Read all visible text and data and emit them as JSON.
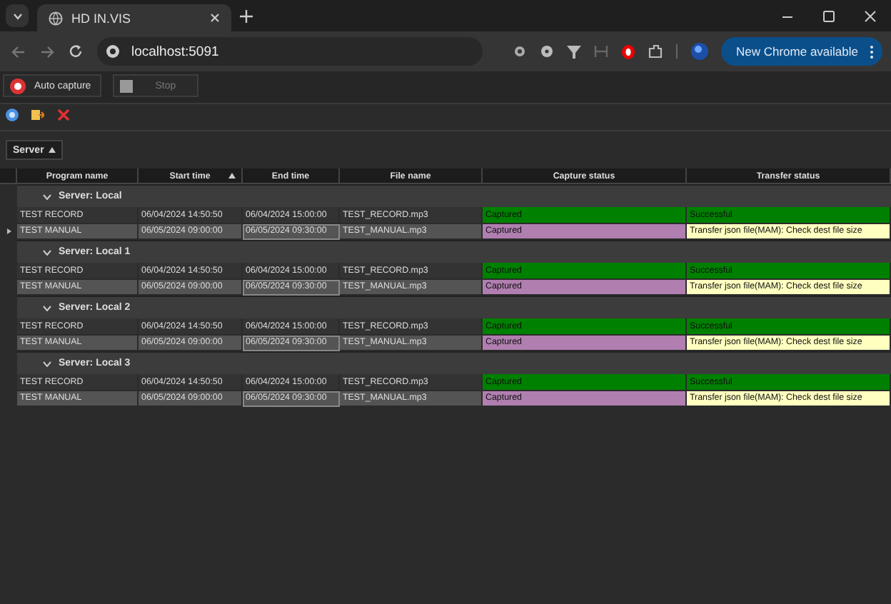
{
  "browser": {
    "tab_title": "HD IN.VIS",
    "url": "localhost:5091",
    "update_button": "New Chrome available"
  },
  "toolbar": {
    "buttons": [
      {
        "label": "Auto capture",
        "disabled": false
      },
      {
        "label": "Stop",
        "disabled": true
      }
    ]
  },
  "group_by": {
    "label": "Server",
    "ascending": true
  },
  "table": {
    "columns": [
      {
        "label": "Program name",
        "sorted": false
      },
      {
        "label": "Start time",
        "sorted": true
      },
      {
        "label": "End time",
        "sorted": false
      },
      {
        "label": "File name",
        "sorted": false
      },
      {
        "label": "Capture status",
        "sorted": false
      },
      {
        "label": "Transfer status",
        "sorted": false
      }
    ],
    "groups": [
      {
        "title": "Server: Local",
        "expanded": true,
        "rows": [
          {
            "current": false,
            "outlined_end": false,
            "cells": [
              "TEST RECORD",
              "06/04/2024 14:50:50",
              "06/04/2024 15:00:00",
              "TEST_RECORD.mp3"
            ],
            "capture": {
              "text": "Captured",
              "color": "#008000"
            },
            "transfer": {
              "text": "Successful",
              "color": "#008000"
            }
          },
          {
            "current": true,
            "outlined_end": true,
            "cells": [
              "TEST MANUAL",
              "06/05/2024 09:00:00",
              "06/05/2024 09:30:00",
              "TEST_MANUAL.mp3"
            ],
            "capture": {
              "text": "Captured",
              "color": "#b07fb0"
            },
            "transfer": {
              "text": "Transfer json file(MAM): Check dest file size",
              "color": "#ffffc0"
            }
          }
        ]
      },
      {
        "title": "Server: Local 1",
        "expanded": true,
        "rows": [
          {
            "current": false,
            "outlined_end": false,
            "cells": [
              "TEST RECORD",
              "06/04/2024 14:50:50",
              "06/04/2024 15:00:00",
              "TEST_RECORD.mp3"
            ],
            "capture": {
              "text": "Captured",
              "color": "#008000"
            },
            "transfer": {
              "text": "Successful",
              "color": "#008000"
            }
          },
          {
            "current": false,
            "outlined_end": true,
            "cells": [
              "TEST MANUAL",
              "06/05/2024 09:00:00",
              "06/05/2024 09:30:00",
              "TEST_MANUAL.mp3"
            ],
            "capture": {
              "text": "Captured",
              "color": "#b07fb0"
            },
            "transfer": {
              "text": "Transfer json file(MAM): Check dest file size",
              "color": "#ffffc0"
            }
          }
        ]
      },
      {
        "title": "Server: Local 2",
        "expanded": true,
        "rows": [
          {
            "current": false,
            "outlined_end": false,
            "cells": [
              "TEST RECORD",
              "06/04/2024 14:50:50",
              "06/04/2024 15:00:00",
              "TEST_RECORD.mp3"
            ],
            "capture": {
              "text": "Captured",
              "color": "#008000"
            },
            "transfer": {
              "text": "Successful",
              "color": "#008000"
            }
          },
          {
            "current": false,
            "outlined_end": true,
            "cells": [
              "TEST MANUAL",
              "06/05/2024 09:00:00",
              "06/05/2024 09:30:00",
              "TEST_MANUAL.mp3"
            ],
            "capture": {
              "text": "Captured",
              "color": "#b07fb0"
            },
            "transfer": {
              "text": "Transfer json file(MAM): Check dest file size",
              "color": "#ffffc0"
            }
          }
        ]
      },
      {
        "title": "Server: Local 3",
        "expanded": true,
        "rows": [
          {
            "current": false,
            "outlined_end": false,
            "cells": [
              "TEST RECORD",
              "06/04/2024 14:50:50",
              "06/04/2024 15:00:00",
              "TEST_RECORD.mp3"
            ],
            "capture": {
              "text": "Captured",
              "color": "#008000"
            },
            "transfer": {
              "text": "Successful",
              "color": "#008000"
            }
          },
          {
            "current": false,
            "outlined_end": true,
            "cells": [
              "TEST MANUAL",
              "06/05/2024 09:00:00",
              "06/05/2024 09:30:00",
              "TEST_MANUAL.mp3"
            ],
            "capture": {
              "text": "Captured",
              "color": "#b07fb0"
            },
            "transfer": {
              "text": "Transfer json file(MAM): Check dest file size",
              "color": "#ffffc0"
            }
          }
        ]
      }
    ]
  }
}
